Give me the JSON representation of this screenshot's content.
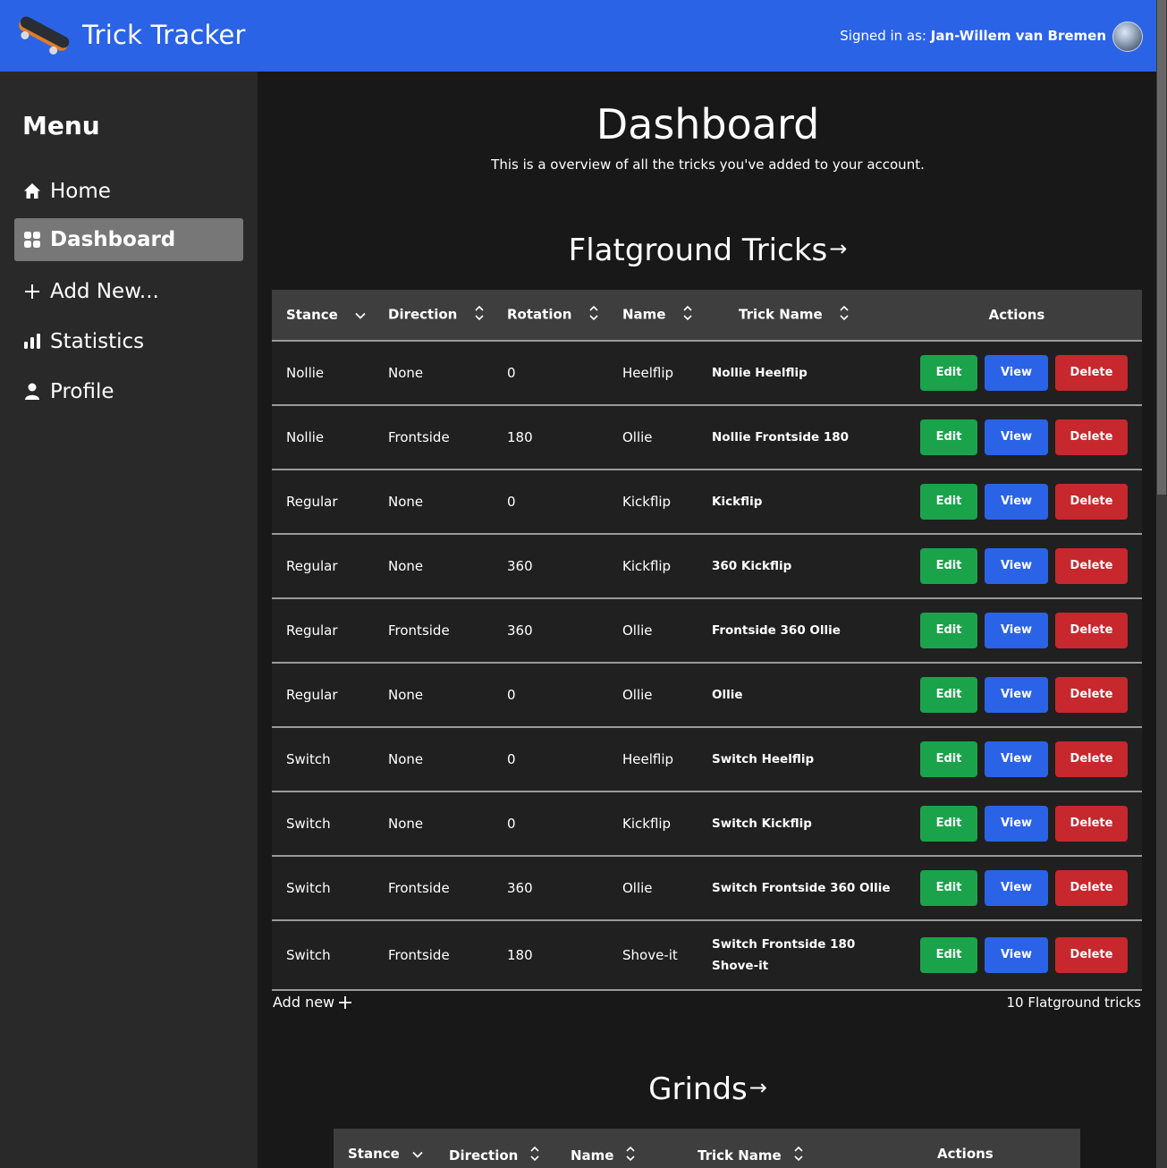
{
  "header": {
    "app_title": "Trick Tracker",
    "signed_in_label": "Signed in as:",
    "user_name": "Jan-Willem van Bremen"
  },
  "sidebar": {
    "title": "Menu",
    "items": [
      {
        "label": "Home",
        "icon": "home-icon",
        "active": false
      },
      {
        "label": "Dashboard",
        "icon": "dashboard-icon",
        "active": true
      },
      {
        "label": "Add New...",
        "icon": "plus-icon",
        "active": false
      },
      {
        "label": "Statistics",
        "icon": "bar-chart-icon",
        "active": false
      },
      {
        "label": "Profile",
        "icon": "user-icon",
        "active": false
      }
    ]
  },
  "main": {
    "title": "Dashboard",
    "subtitle": "This is a overview of all the tricks you've added to your account."
  },
  "flatground": {
    "title": "Flatground Tricks",
    "arrow": "→",
    "columns": [
      "Stance",
      "Direction",
      "Rotation",
      "Name",
      "Trick Name",
      "Actions"
    ],
    "rows": [
      {
        "stance": "Nollie",
        "direction": "None",
        "rotation": "0",
        "name": "Heelflip",
        "trick_name": "Nollie Heelflip"
      },
      {
        "stance": "Nollie",
        "direction": "Frontside",
        "rotation": "180",
        "name": "Ollie",
        "trick_name": "Nollie Frontside 180"
      },
      {
        "stance": "Regular",
        "direction": "None",
        "rotation": "0",
        "name": "Kickflip",
        "trick_name": "Kickflip"
      },
      {
        "stance": "Regular",
        "direction": "None",
        "rotation": "360",
        "name": "Kickflip",
        "trick_name": "360 Kickflip"
      },
      {
        "stance": "Regular",
        "direction": "Frontside",
        "rotation": "360",
        "name": "Ollie",
        "trick_name": "Frontside 360 Ollie"
      },
      {
        "stance": "Regular",
        "direction": "None",
        "rotation": "0",
        "name": "Ollie",
        "trick_name": "Ollie"
      },
      {
        "stance": "Switch",
        "direction": "None",
        "rotation": "0",
        "name": "Heelflip",
        "trick_name": "Switch Heelflip"
      },
      {
        "stance": "Switch",
        "direction": "None",
        "rotation": "0",
        "name": "Kickflip",
        "trick_name": "Switch Kickflip"
      },
      {
        "stance": "Switch",
        "direction": "Frontside",
        "rotation": "360",
        "name": "Ollie",
        "trick_name": "Switch Frontside 360 Ollie"
      },
      {
        "stance": "Switch",
        "direction": "Frontside",
        "rotation": "180",
        "name": "Shove-it",
        "trick_name": "Switch Frontside 180 Shove-it"
      }
    ],
    "actions": {
      "edit": "Edit",
      "view": "View",
      "delete": "Delete"
    },
    "add_new_label": "Add new",
    "count_label": "10 Flatground tricks"
  },
  "grinds": {
    "title": "Grinds",
    "arrow": "→",
    "columns": [
      "Stance",
      "Direction",
      "Name",
      "Trick Name",
      "Actions"
    ]
  },
  "colors": {
    "header_blue": "#2b63e6",
    "edit_green": "#1aa34a",
    "view_blue": "#2b63e6",
    "delete_red": "#c6282d"
  }
}
